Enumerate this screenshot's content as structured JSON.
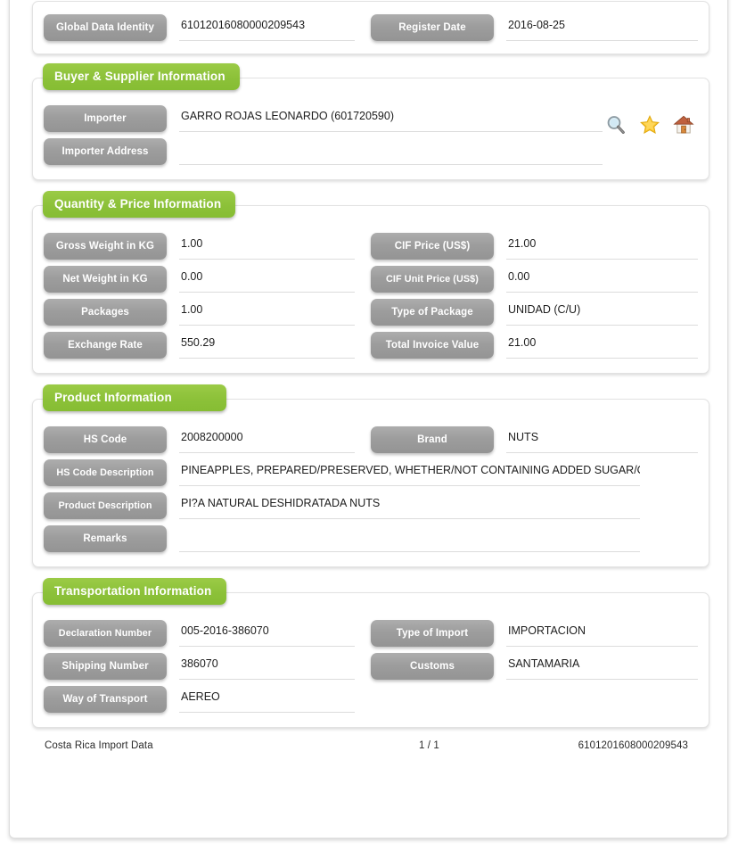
{
  "document": {
    "footer": {
      "source": "Costa Rica Import Data",
      "page": "1 / 1",
      "record_id": "6101201608000209543"
    }
  },
  "theme": {
    "green": "#8cc139",
    "gray": "#9d9d9d",
    "rule": "#dcdcdc"
  },
  "header_section": {
    "fields": [
      {
        "label": "Global Data Identity",
        "value": "61012016080000209543"
      },
      {
        "label": "Register Date",
        "value": "2016-08-25"
      }
    ]
  },
  "buyer_supplier": {
    "title": "Buyer & Supplier Information",
    "fields": [
      {
        "label": "Importer",
        "value": "GARRO ROJAS LEONARDO (601720590)"
      },
      {
        "label": "Importer Address",
        "value": ""
      }
    ],
    "actions": [
      {
        "name": "search-icon",
        "title": "Search"
      },
      {
        "name": "star-icon",
        "title": "Favorite"
      },
      {
        "name": "home-icon",
        "title": "Home"
      }
    ]
  },
  "quantity_price": {
    "title": "Quantity & Price Information",
    "rows": [
      {
        "left": {
          "label": "Gross Weight in KG",
          "value": "1.00"
        },
        "right": {
          "label": "CIF Price (US$)",
          "value": "21.00"
        }
      },
      {
        "left": {
          "label": "Net Weight in KG",
          "value": "0.00"
        },
        "right": {
          "label": "CIF Unit Price (US$)",
          "value": "0.00"
        }
      },
      {
        "left": {
          "label": "Packages",
          "value": "1.00"
        },
        "right": {
          "label": "Type of Package",
          "value": "UNIDAD (C/U)"
        }
      },
      {
        "left": {
          "label": "Exchange Rate",
          "value": "550.29"
        },
        "right": {
          "label": "Total Invoice Value",
          "value": "21.00"
        }
      }
    ]
  },
  "product": {
    "title": "Product Information",
    "row1": {
      "left": {
        "label": "HS Code",
        "value": "2008200000"
      },
      "right": {
        "label": "Brand",
        "value": "NUTS"
      }
    },
    "full_rows": [
      {
        "label": "HS Code Description",
        "value": "PINEAPPLES, PREPARED/PRESERVED, WHETHER/NOT CONTAINING ADDED SUGAR/OTH"
      },
      {
        "label": "Product Description",
        "value": "PI?A NATURAL DESHIDRATADA NUTS"
      },
      {
        "label": "Remarks",
        "value": ""
      }
    ]
  },
  "transportation": {
    "title": "Transportation Information",
    "rows": [
      {
        "left": {
          "label": "Declaration Number",
          "value": "005-2016-386070"
        },
        "right": {
          "label": "Type of Import",
          "value": "IMPORTACION"
        }
      },
      {
        "left": {
          "label": "Shipping Number",
          "value": "386070"
        },
        "right": {
          "label": "Customs",
          "value": "SANTAMARIA"
        }
      },
      {
        "left": {
          "label": "Way of Transport",
          "value": "AEREO"
        },
        "right": {
          "label": "",
          "value": ""
        }
      }
    ]
  }
}
